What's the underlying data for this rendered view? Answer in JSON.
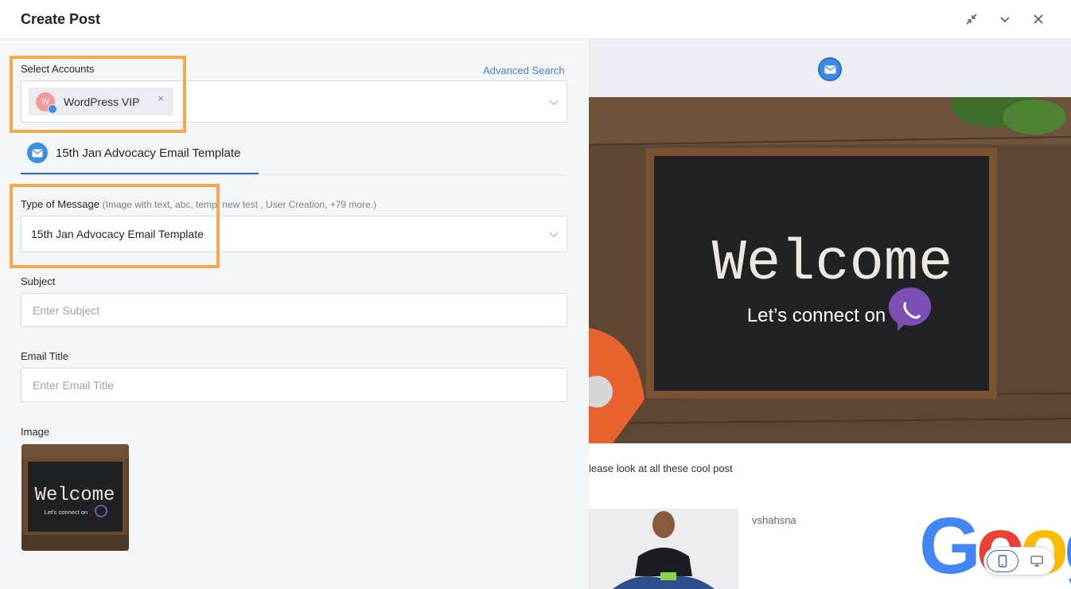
{
  "header": {
    "title": "Create Post",
    "icons": [
      "collapse-icon",
      "chevron-down-icon",
      "close-icon"
    ]
  },
  "form": {
    "select_accounts_label": "Select Accounts",
    "advanced_search": "Advanced Search",
    "account_chip": {
      "initial": "W",
      "name": "WordPress VIP",
      "remove": "×"
    },
    "tab_label": "15th Jan Advocacy Email Template",
    "type_label": "Type of Message",
    "type_hint": "(Image with text, abc, temp, new test , User Creation, +79 more.)",
    "type_value": "15th Jan Advocacy Email Template",
    "subject_label": "Subject",
    "subject_placeholder": "Enter  Subject",
    "email_title_label": "Email Title",
    "email_title_placeholder": "Enter  Email Title",
    "image_label": "Image"
  },
  "thumbnail": {
    "headline": "Welcome",
    "subline": "Let's connect on"
  },
  "preview": {
    "headline": "Welcome",
    "subline": "Let’s  connect on",
    "body_text": "lease look at all these cool post",
    "username": "vshahsna",
    "google_word": "Google"
  },
  "colors": {
    "accent": "#2d64d4",
    "highlight": "#f5a94a",
    "link": "#4a7bd9",
    "viber": "#7b4fb3"
  }
}
